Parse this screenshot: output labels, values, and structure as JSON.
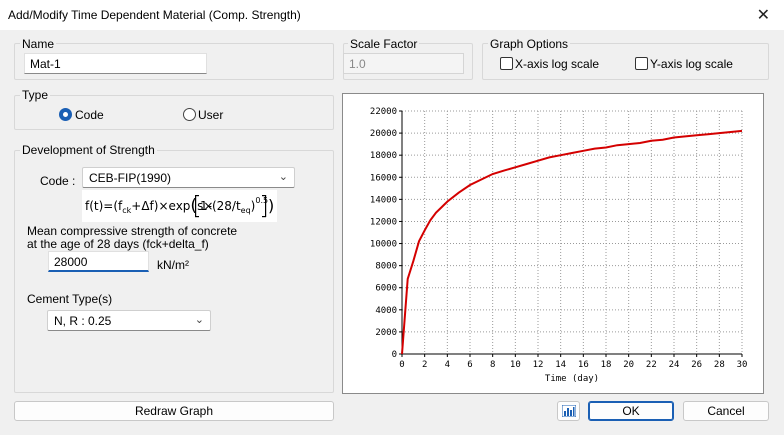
{
  "window": {
    "title": "Add/Modify Time Dependent Material (Comp. Strength)",
    "close_glyph": "✕"
  },
  "name_group": {
    "label": "Name",
    "value": "Mat-1"
  },
  "scale_group": {
    "label": "Scale Factor",
    "value": "1.0"
  },
  "graph_options": {
    "label": "Graph Options",
    "x_log": {
      "label": "X-axis log scale",
      "checked": false
    },
    "y_log": {
      "label": "Y-axis log scale",
      "checked": false
    }
  },
  "type_group": {
    "label": "Type",
    "code_label": "Code",
    "user_label": "User",
    "selected": "Code"
  },
  "strength_group": {
    "label": "Development of Strength",
    "code_label": "Code :",
    "code_value": "CEB-FIP(1990)",
    "mean_label_1": "Mean compressive strength of concrete",
    "mean_label_2": "at the age of 28 days (fck+delta_f)",
    "mean_value": "28000",
    "unit": "kN/m²",
    "cement_label": "Cement Type(s)",
    "cement_value": "N, R : 0.25"
  },
  "formula": {
    "text": "f(t)=(fck+Δf)×exp[s×[1−(28/teq)^0.5]]"
  },
  "buttons": {
    "redraw": "Redraw Graph",
    "ok": "OK",
    "cancel": "Cancel",
    "chart_icon": "bar-chart-icon"
  },
  "chart_data": {
    "type": "line",
    "xlabel": "Time (day)",
    "ylabel": "",
    "xlim": [
      0,
      30
    ],
    "ylim": [
      0,
      22000
    ],
    "x_ticks": [
      0,
      2,
      4,
      6,
      8,
      10,
      12,
      14,
      16,
      18,
      20,
      22,
      24,
      26,
      28,
      30
    ],
    "y_ticks": [
      0,
      2000,
      4000,
      6000,
      8000,
      10000,
      12000,
      14000,
      16000,
      18000,
      20000,
      22000
    ],
    "grid": true,
    "series": [
      {
        "color": "#d40000",
        "x": [
          0,
          0.5,
          1,
          1.5,
          2,
          2.5,
          3,
          3.5,
          4,
          5,
          6,
          7,
          8,
          9,
          10,
          11,
          12,
          13,
          14,
          15,
          16,
          17,
          18,
          19,
          20,
          21,
          22,
          23,
          24,
          25,
          26,
          27,
          28,
          29,
          30
        ],
        "y": [
          0,
          6800,
          8400,
          10200,
          11200,
          12100,
          12800,
          13300,
          13800,
          14600,
          15300,
          15800,
          16300,
          16600,
          16900,
          17200,
          17500,
          17800,
          18000,
          18200,
          18400,
          18600,
          18700,
          18900,
          19000,
          19100,
          19300,
          19400,
          19600,
          19700,
          19800,
          19900,
          20000,
          20100,
          20200
        ]
      }
    ]
  }
}
